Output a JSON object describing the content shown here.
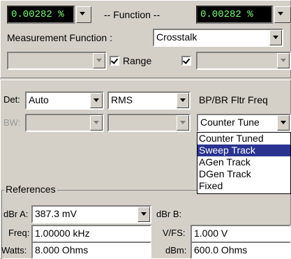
{
  "top_bar": {
    "left_display": "0.00282  %",
    "function_label": "-- Function --",
    "right_display": "0.00282  %"
  },
  "measurement": {
    "label": "Measurement Function :",
    "value": "Crosstalk"
  },
  "range_row": {
    "range_label": "Range",
    "range_checked": true,
    "right_checked": true
  },
  "detector": {
    "det_label": "Det:",
    "det_value": "Auto",
    "rms_value": "RMS",
    "bw_label": "BW:",
    "bpbr_label": "BP/BR Fltr Freq",
    "bpbr_value": "Counter Tune"
  },
  "dropdown": {
    "options": [
      "Counter Tuned",
      "Sweep Track",
      "AGen Track",
      "DGen Track",
      "Fixed"
    ],
    "selected_index": 1
  },
  "references": {
    "title": "References",
    "dbra_label": "dBr A:",
    "dbra_value": "387.3  mV",
    "dbrb_label": "dBr B:",
    "freq_label": "Freq:",
    "freq_value": "1.00000 kHz",
    "vfs_label": "V/FS:",
    "vfs_value": "1.000   V",
    "watts_label": "Watts:",
    "watts_value": "8.000   Ohms",
    "dbm_label": "dBm:",
    "dbm_value": "600.0   Ohms"
  },
  "colors": {
    "panel": "#d4d0c8",
    "display_bg": "#000000",
    "display_fg": "#7dff7d",
    "selection": "#2a3490"
  }
}
